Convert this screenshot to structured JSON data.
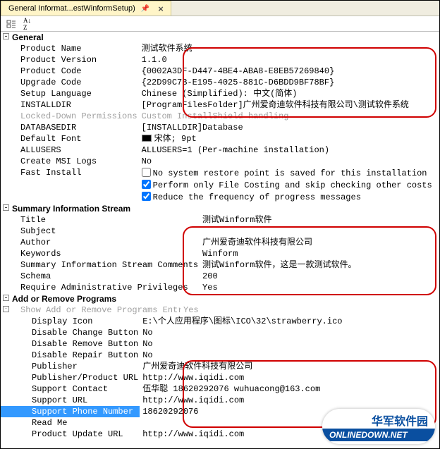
{
  "tab": {
    "title": "General Informat...estWinformSetup)"
  },
  "sections": {
    "general": {
      "title": "General",
      "rows": [
        {
          "label": "Product Name",
          "value": "测试软件系统"
        },
        {
          "label": "Product Version",
          "value": "1.1.0"
        },
        {
          "label": "Product Code",
          "value": "{0002A3DF-D447-4BE4-ABA8-E8EB57269840}"
        },
        {
          "label": "Upgrade Code",
          "value": "{22D99C7B-E195-4025-881C-D6BDD9BF78BF}"
        },
        {
          "label": "Setup Language",
          "value": "Chinese (Simplified): 中文(简体)"
        },
        {
          "label": "INSTALLDIR",
          "value": "[ProgramFilesFolder]广州爱奇迪软件科技有限公司\\测试软件系统"
        },
        {
          "label": "Locked-Down Permissions",
          "value": "Custom InstallShield handling",
          "dim": true
        },
        {
          "label": "DATABASEDIR",
          "value": "[INSTALLDIR]Database"
        },
        {
          "label": "Default Font",
          "value": "宋体; 9pt",
          "color": true
        },
        {
          "label": "ALLUSERS",
          "value": "ALLUSERS=1 (Per-machine installation)"
        },
        {
          "label": "Create MSI Logs",
          "value": "No"
        },
        {
          "label": "Fast Install",
          "value": "",
          "multi": [
            {
              "checked": false,
              "text": "No system restore point is saved for this installation"
            },
            {
              "checked": true,
              "text": "Perform only File Costing and skip checking other costs"
            },
            {
              "checked": true,
              "text": "Reduce the frequency of progress messages"
            }
          ]
        }
      ]
    },
    "summary": {
      "title": "Summary Information Stream",
      "rows": [
        {
          "label": "Title",
          "value": "测试Winform软件"
        },
        {
          "label": "Subject",
          "value": ""
        },
        {
          "label": "Author",
          "value": "广州爱奇迪软件科技有限公司"
        },
        {
          "label": "Keywords",
          "value": "  Winform"
        },
        {
          "label": "Summary Information Stream Comments",
          "value": "测试Winform软件，这是一款测试软件。"
        },
        {
          "label": "Schema",
          "value": "200"
        },
        {
          "label": "Require Administrative Privileges",
          "value": "Yes"
        }
      ]
    },
    "arp": {
      "title": "Add or Remove Programs",
      "sub": {
        "label": "Show Add or Remove Programs Entry",
        "value": "Yes"
      },
      "rows": [
        {
          "label": "Display Icon",
          "value": "E:\\个人应用程序\\图标\\ICO\\32\\strawberry.ico"
        },
        {
          "label": "Disable Change Button",
          "value": "No"
        },
        {
          "label": "Disable Remove Button",
          "value": "No"
        },
        {
          "label": "Disable Repair Button",
          "value": "No"
        },
        {
          "label": "Publisher",
          "value": "广州爱奇迪软件科技有限公司"
        },
        {
          "label": "Publisher/Product URL",
          "value": "http://www.iqidi.com"
        },
        {
          "label": "Support Contact",
          "value": "伍华聪 18620292076 wuhuacong@163.com"
        },
        {
          "label": "Support URL",
          "value": "http://www.iqidi.com"
        },
        {
          "label": "Support Phone Number",
          "value": "18620292076",
          "selected": true
        },
        {
          "label": "Read Me",
          "value": ""
        },
        {
          "label": "Product Update URL",
          "value": "http://www.iqidi.com"
        }
      ]
    }
  },
  "watermark": {
    "top": "华军软件园",
    "bottom": "ONLINEDOWN.NET"
  }
}
